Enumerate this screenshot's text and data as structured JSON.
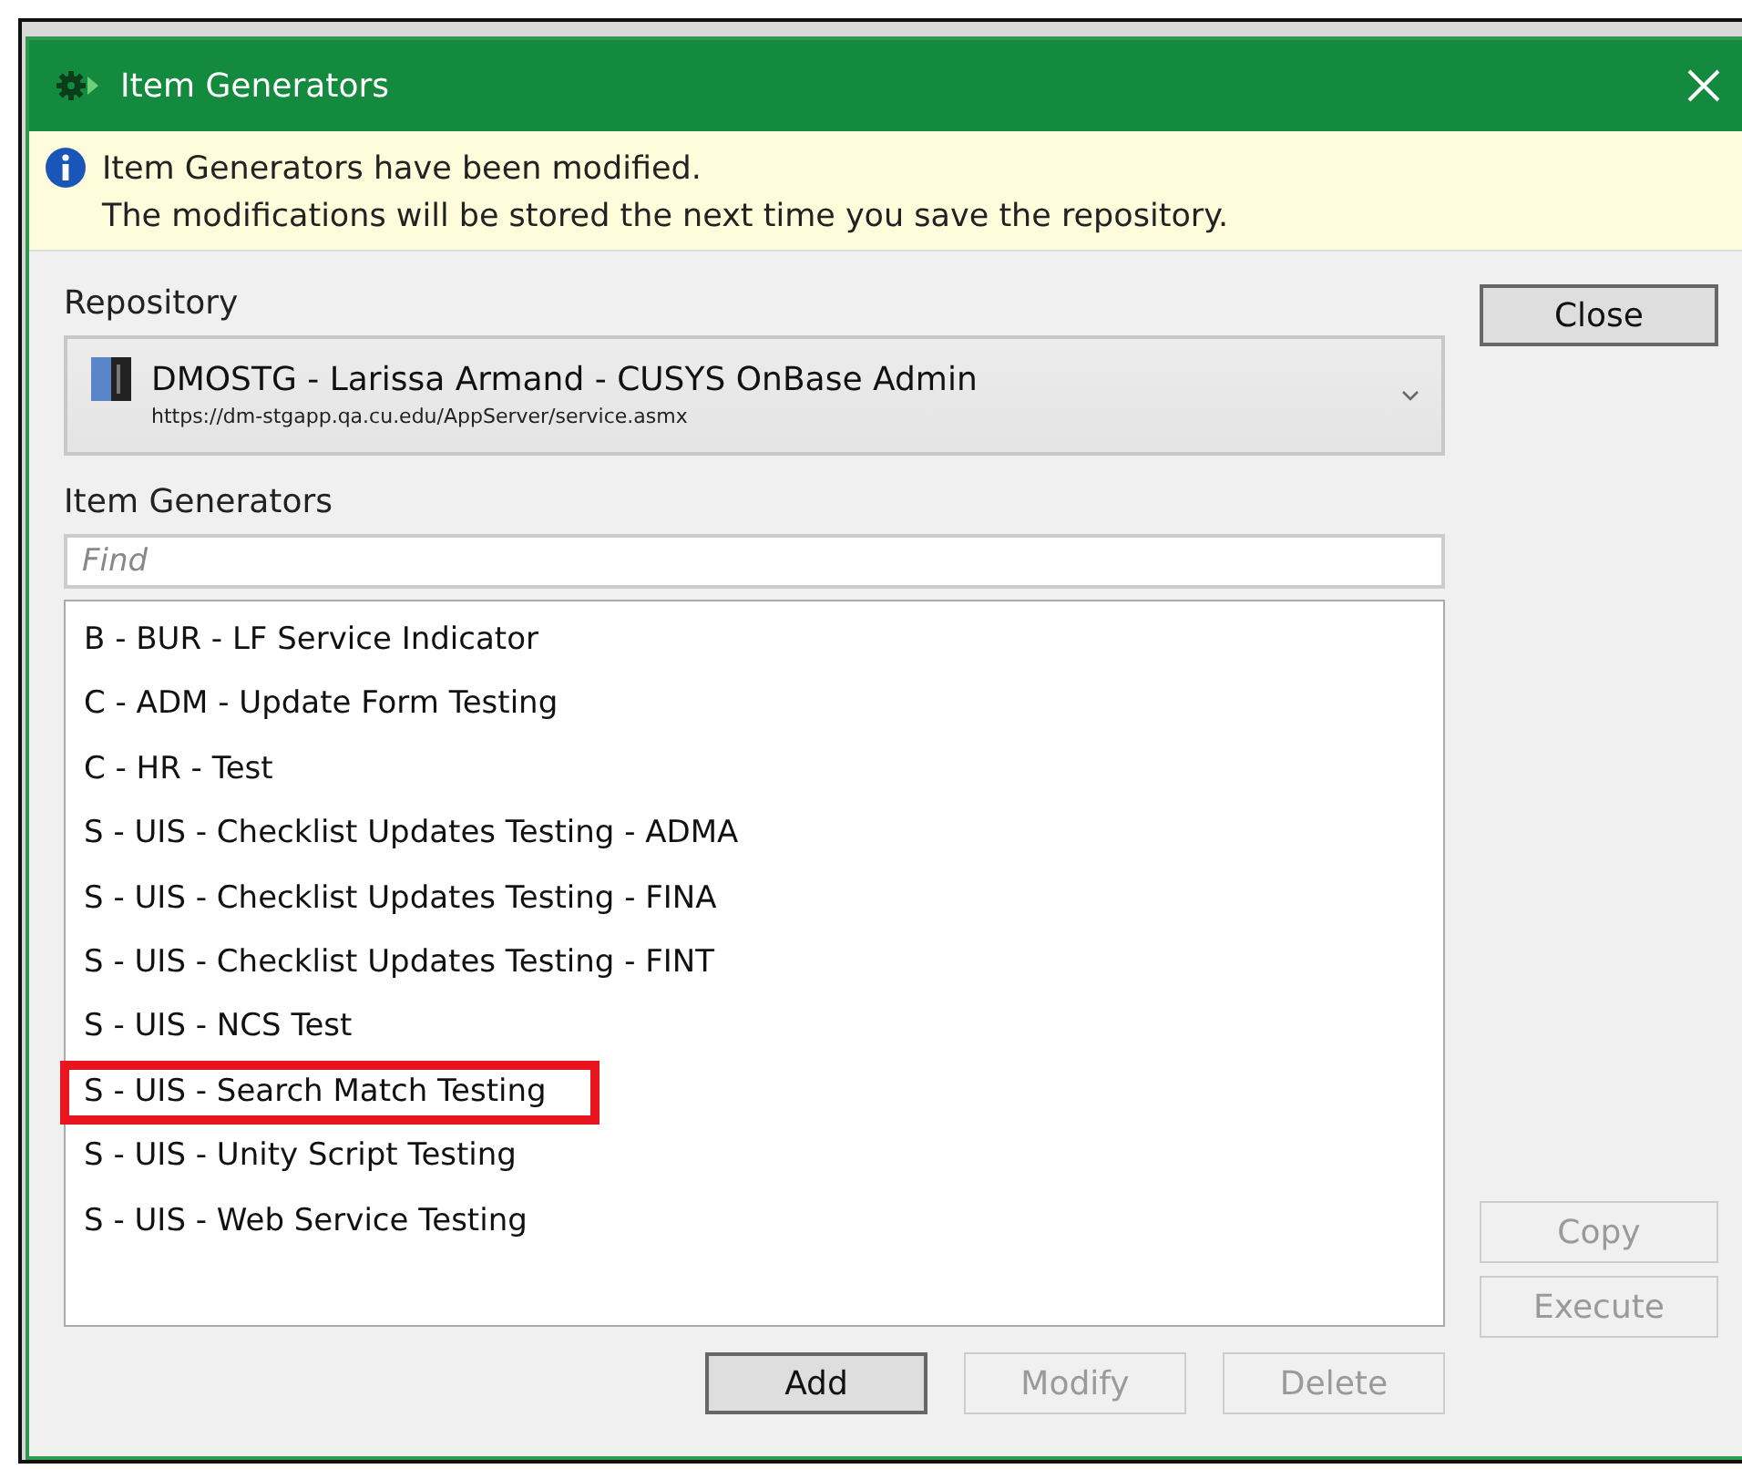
{
  "window": {
    "title": "Item Generators"
  },
  "notice": {
    "lines": [
      "Item Generators have been modified.",
      "The modifications will be stored the next time you save the repository."
    ]
  },
  "repository": {
    "label": "Repository",
    "name": "DMOSTG - Larissa Armand - CUSYS OnBase Admin",
    "url": "https://dm-stgapp.qa.cu.edu/AppServer/service.asmx"
  },
  "item_generators": {
    "label": "Item Generators",
    "search": {
      "placeholder": "Find"
    },
    "items": [
      {
        "label": "B - BUR - LF Service Indicator",
        "highlighted": false
      },
      {
        "label": "C - ADM - Update Form Testing",
        "highlighted": false
      },
      {
        "label": "C - HR - Test",
        "highlighted": false
      },
      {
        "label": "S - UIS - Checklist Updates Testing - ADMA",
        "highlighted": false
      },
      {
        "label": "S - UIS - Checklist Updates Testing - FINA",
        "highlighted": false
      },
      {
        "label": "S - UIS - Checklist Updates Testing - FINT",
        "highlighted": false
      },
      {
        "label": "S - UIS - NCS Test",
        "highlighted": false
      },
      {
        "label": "S - UIS - Search Match Testing",
        "highlighted": true
      },
      {
        "label": "S - UIS - Unity Script Testing",
        "highlighted": false
      },
      {
        "label": "S - UIS - Web Service Testing",
        "highlighted": false
      }
    ]
  },
  "side_top_buttons": [
    {
      "label": "Close",
      "disabled": false,
      "default": true
    }
  ],
  "side_bottom_buttons": [
    {
      "label": "Copy",
      "disabled": true,
      "default": false
    },
    {
      "label": "Execute",
      "disabled": true,
      "default": false
    }
  ],
  "bottom_buttons": [
    {
      "label": "Add",
      "disabled": false,
      "default": true
    },
    {
      "label": "Modify",
      "disabled": true,
      "default": false
    },
    {
      "label": "Delete",
      "disabled": true,
      "default": false
    }
  ]
}
